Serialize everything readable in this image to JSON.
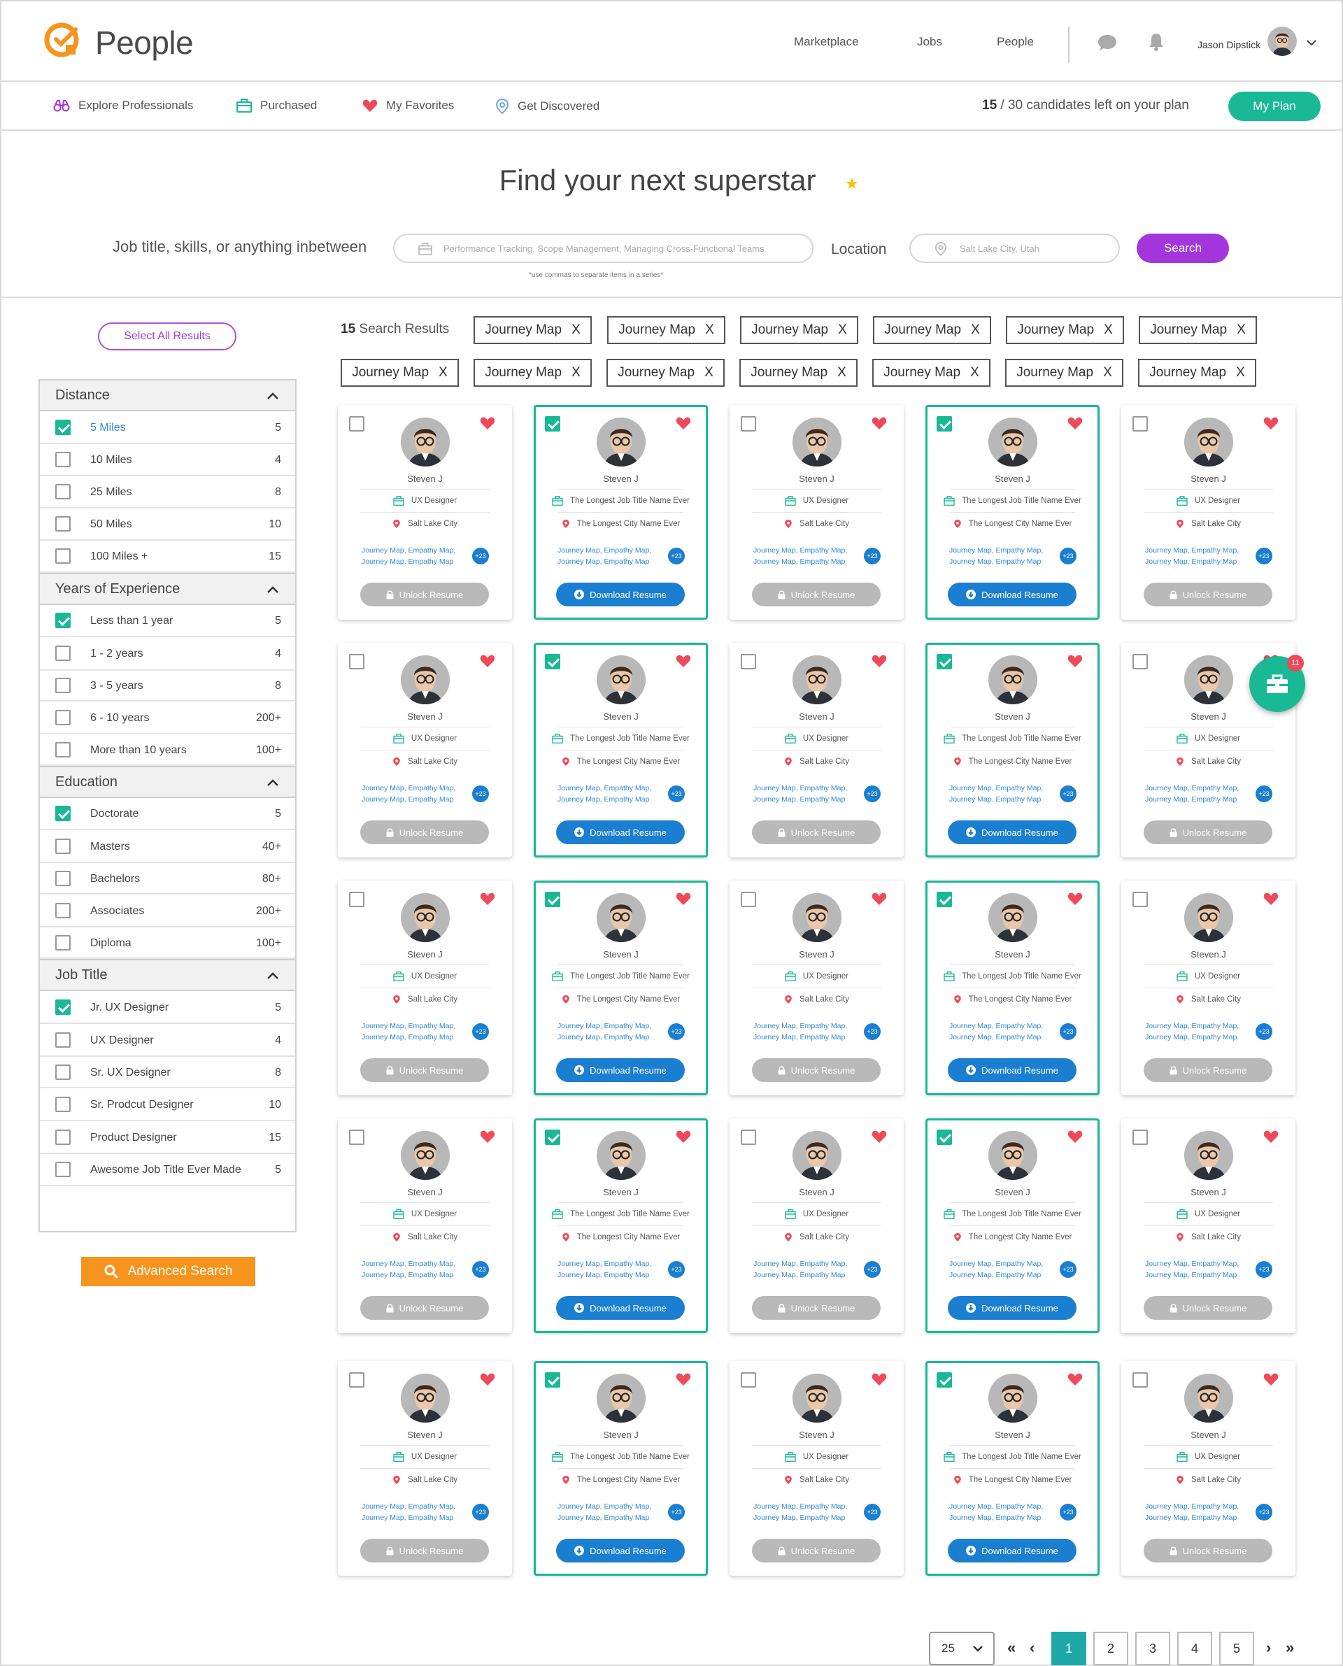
{
  "header": {
    "brand": "People",
    "nav": [
      "Marketplace",
      "Jobs",
      "People"
    ],
    "user_name": "Jason Dipstick"
  },
  "subnav": {
    "items": [
      {
        "label": "Explore Professionals",
        "icon": "binoculars-icon"
      },
      {
        "label": "Purchased",
        "icon": "briefcase-icon"
      },
      {
        "label": "My Favorites",
        "icon": "heart-icon"
      },
      {
        "label": "Get Discovered",
        "icon": "location-pin-icon"
      }
    ],
    "plan_used": "15",
    "plan_rest": " / 30 candidates left on your plan",
    "plan_button": "My Plan"
  },
  "hero": {
    "title": "Find your next superstar",
    "search_label": "Job title, skills, or anything inbetween",
    "search_placeholder": "Performance Tracking, Scope Management, Managing Cross-Functional Teams",
    "location_label": "Location",
    "location_placeholder": "Salt Lake City, Utah",
    "search_button": "Search",
    "hint": "*use commas to separate items in a series*"
  },
  "sidebar": {
    "select_all": "Select All Results",
    "advanced_search": "Advanced Search",
    "groups": [
      {
        "title": "Distance",
        "items": [
          {
            "label": "5 Miles",
            "count": "5",
            "checked": true
          },
          {
            "label": "10 Miles",
            "count": "4",
            "checked": false
          },
          {
            "label": "25 Miles",
            "count": "8",
            "checked": false
          },
          {
            "label": "50 Miles",
            "count": "10",
            "checked": false
          },
          {
            "label": "100 Miles +",
            "count": "15",
            "checked": false
          }
        ]
      },
      {
        "title": "Years of Experience",
        "items": [
          {
            "label": "Less than 1 year",
            "count": "5",
            "checked": true
          },
          {
            "label": "1 - 2 years",
            "count": "4",
            "checked": false
          },
          {
            "label": "3 - 5 years",
            "count": "8",
            "checked": false
          },
          {
            "label": "6 - 10 years",
            "count": "200+",
            "checked": false
          },
          {
            "label": "More than 10 years",
            "count": "100+",
            "checked": false
          }
        ]
      },
      {
        "title": "Education",
        "items": [
          {
            "label": "Doctorate",
            "count": "5",
            "checked": true
          },
          {
            "label": "Masters",
            "count": "40+",
            "checked": false
          },
          {
            "label": "Bachelors",
            "count": "80+",
            "checked": false
          },
          {
            "label": "Associates",
            "count": "200+",
            "checked": false
          },
          {
            "label": "Diploma",
            "count": "100+",
            "checked": false
          }
        ]
      },
      {
        "title": "Job Title",
        "items": [
          {
            "label": "Jr. UX Designer",
            "count": "5",
            "checked": true
          },
          {
            "label": "UX Designer",
            "count": "4",
            "checked": false
          },
          {
            "label": "Sr. UX Designer",
            "count": "8",
            "checked": false
          },
          {
            "label": "Sr. Prodcut Designer",
            "count": "10",
            "checked": false
          },
          {
            "label": "Product Designer",
            "count": "15",
            "checked": false
          },
          {
            "label": "Awesome Job Title Ever Made",
            "count": "5",
            "checked": false
          }
        ]
      }
    ]
  },
  "results": {
    "count": "15",
    "count_label": " Search Results",
    "tags": [
      "Journey Map",
      "Journey Map",
      "Journey Map",
      "Journey Map",
      "Journey Map",
      "Journey Map",
      "Journey Map",
      "Journey Map",
      "Journey Map",
      "Journey Map",
      "Journey Map",
      "Journey Map",
      "Journey Map"
    ],
    "tag_close": "X"
  },
  "card_variants": {
    "locked": {
      "name": "Steven J",
      "job": "UX Designer",
      "city": "Salt Lake City",
      "skills_line1": "Journey Map, Empathy Map,",
      "skills_line2": "Journey Map, Empathy Map",
      "more": "+23",
      "button": "Unlock Resume",
      "selected": false
    },
    "purchased": {
      "name": "Steven J",
      "job": "The Longest Job Title Name Ever",
      "city": "The Longest City Name Ever",
      "skills_line1": "Journey Map, Empathy Map,",
      "skills_line2": "Journey Map, Empathy Map",
      "more": "+23",
      "button": "Download Resume",
      "selected": true
    }
  },
  "card_grid": [
    [
      "locked",
      "purchased",
      "locked",
      "purchased",
      "locked"
    ],
    [
      "locked",
      "purchased",
      "locked",
      "purchased",
      "locked"
    ],
    [
      "locked",
      "purchased",
      "locked",
      "purchased",
      "locked"
    ],
    [
      "locked",
      "purchased",
      "locked",
      "purchased",
      "locked"
    ],
    [
      "locked",
      "purchased",
      "locked",
      "purchased",
      "locked"
    ]
  ],
  "fab": {
    "badge": "11",
    "icon": "briefcase-icon"
  },
  "pagination": {
    "per_page": "25",
    "pages": [
      "1",
      "2",
      "3",
      "4",
      "5"
    ],
    "active": "1",
    "first": "«",
    "prev": "‹",
    "next": "›",
    "last": "»"
  },
  "colors": {
    "accent_green": "#19b996",
    "accent_purple": "#a236dc",
    "accent_orange": "#f7941d",
    "link_blue": "#1b7fd1",
    "heart_red": "#ef4a5a"
  }
}
